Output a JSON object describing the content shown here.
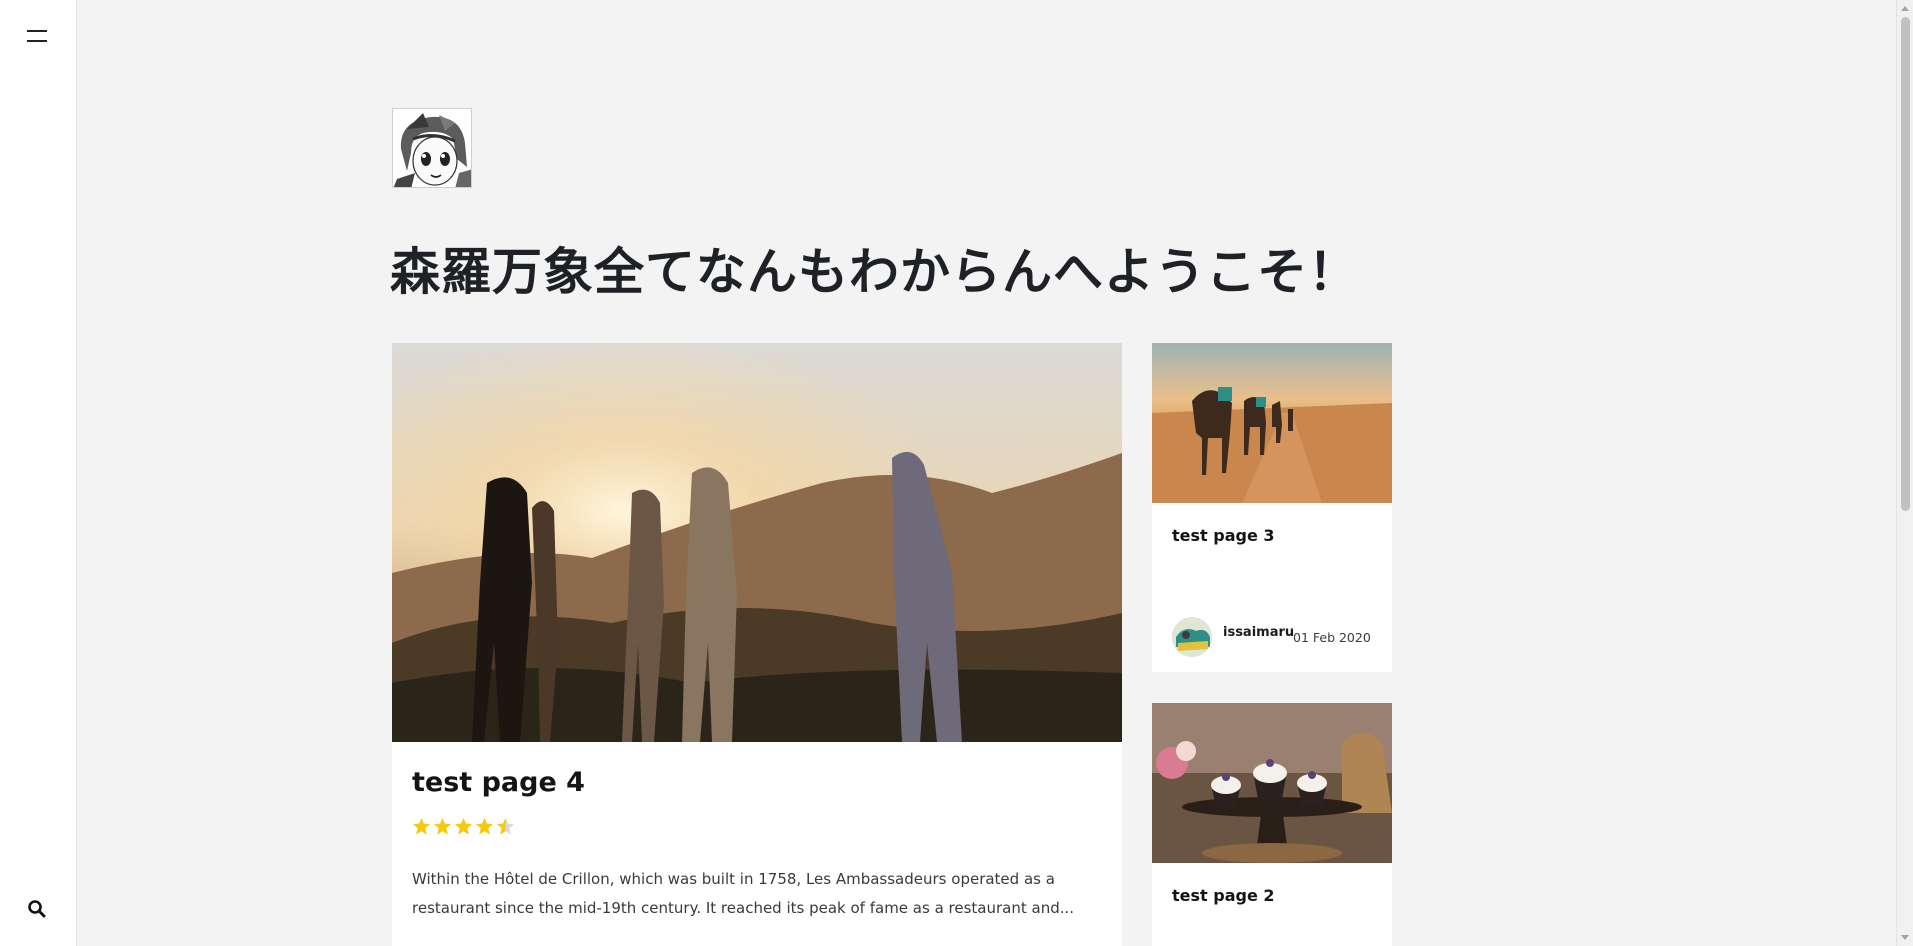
{
  "site": {
    "title": "森羅万象全てなんもわからんへようこそ！"
  },
  "featured_post": {
    "title": "test page 4",
    "rating": 4.5,
    "rating_max": 5,
    "excerpt": "Within the Hôtel de Crillon, which was built in 1758, Les Ambassadeurs operated as a restaurant since the mid-19th century. It reached its peak of fame as a restaurant and...",
    "image": "group-of-friends-at-sunset-photo"
  },
  "side_posts": [
    {
      "title": "test page 3",
      "image": "camels-in-desert-photo",
      "author": "issaimaru",
      "date": "01 Feb 2020"
    },
    {
      "title": "test page 2",
      "image": "cupcakes-on-stand-photo"
    }
  ],
  "icons": {
    "menu": "hamburger-menu-icon",
    "search": "search-icon",
    "star": "star-icon"
  },
  "colors": {
    "background": "#f3f3f3",
    "card": "#ffffff",
    "star": "#f6c911",
    "text": "#1e2126"
  }
}
